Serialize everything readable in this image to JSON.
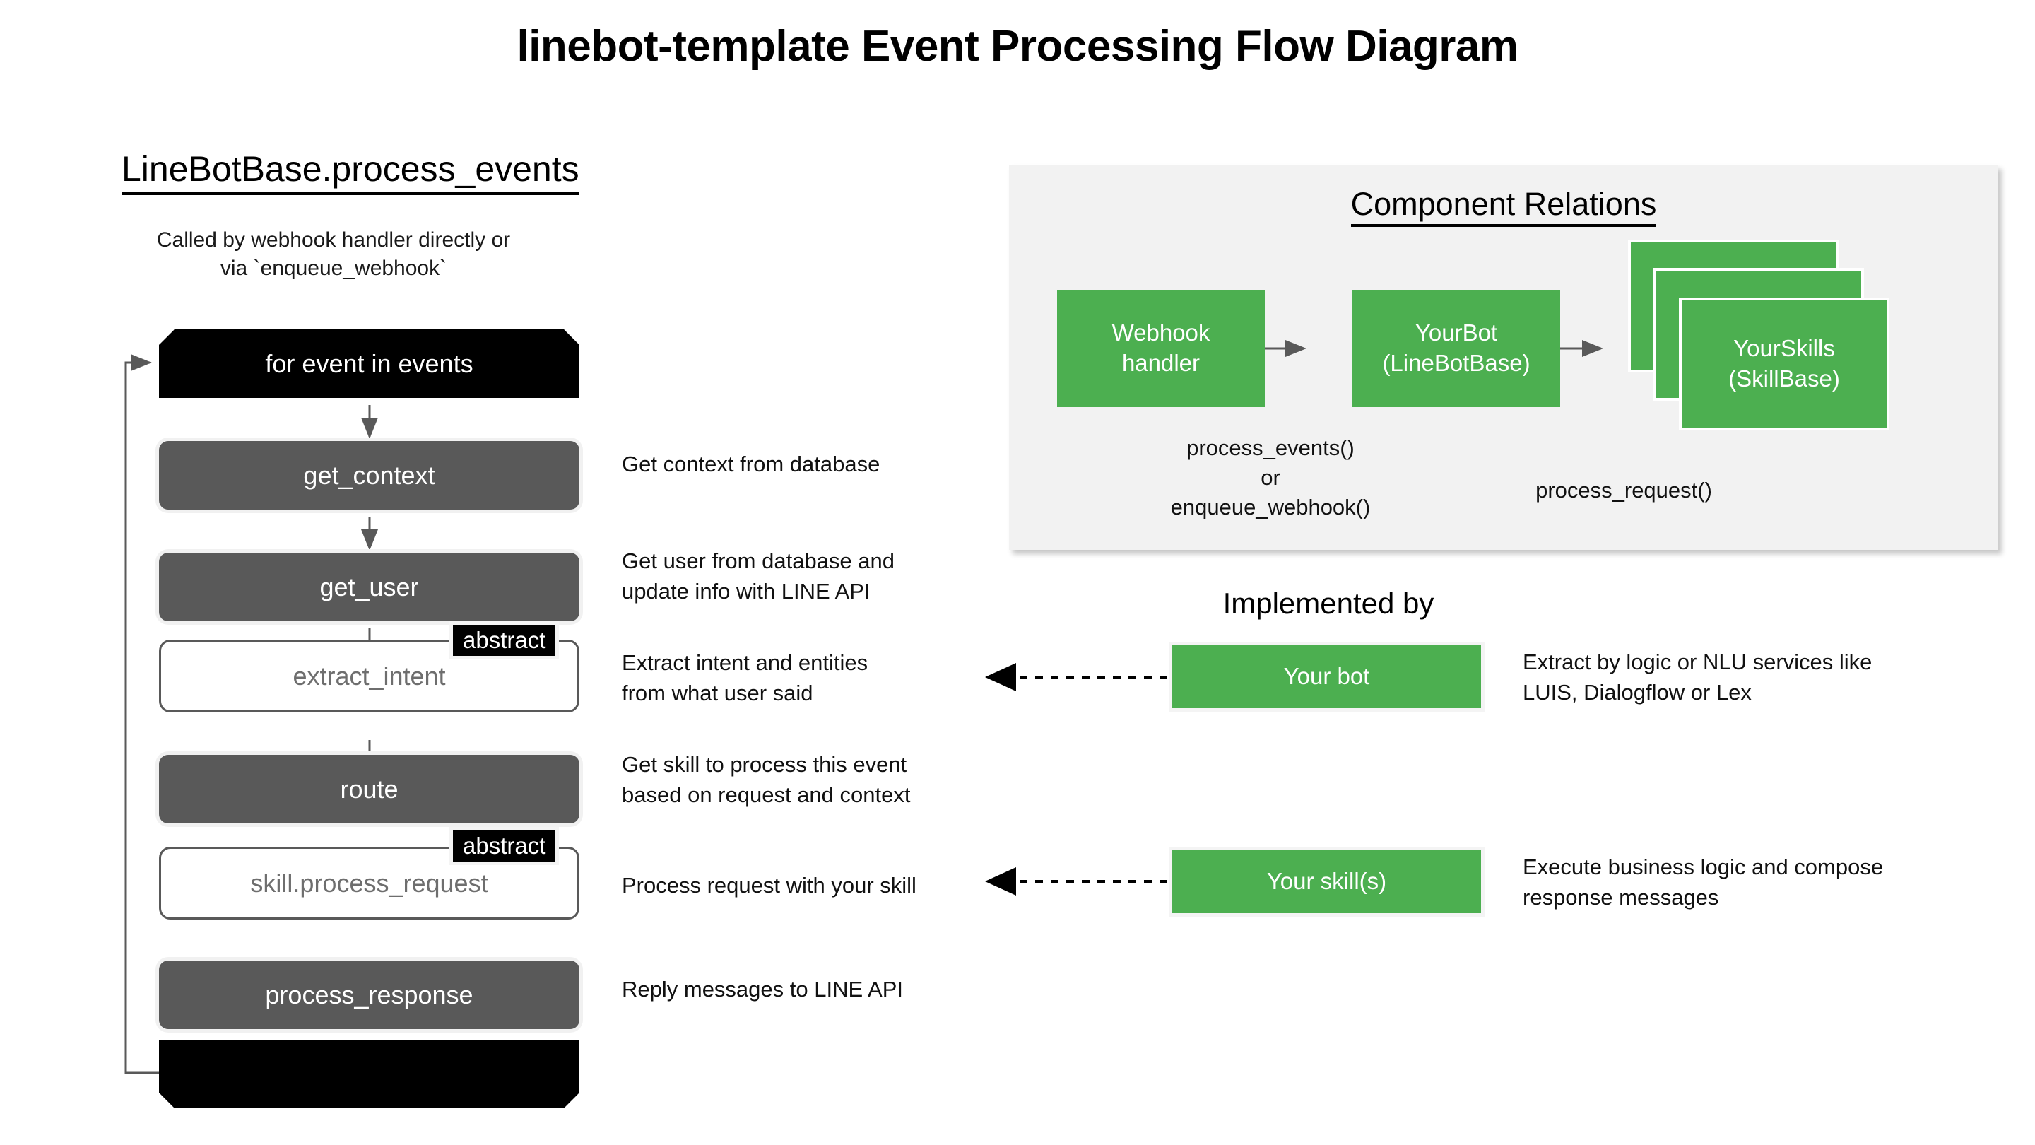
{
  "title": "linebot-template Event Processing Flow Diagram",
  "flow": {
    "heading": "LineBotBase.process_events",
    "subtitle": "Called by webhook handler directly or\nvia `enqueue_webhook`",
    "abstract_badge": "abstract",
    "nodes": [
      {
        "label": "for event in events",
        "style": "loop-start",
        "annotation": ""
      },
      {
        "label": "get_context",
        "style": "gray",
        "annotation": "Get context from database"
      },
      {
        "label": "get_user",
        "style": "gray",
        "annotation": "Get user from database and\nupdate info with LINE API"
      },
      {
        "label": "extract_intent",
        "style": "abstract",
        "annotation": "Extract intent and entities\nfrom what user said"
      },
      {
        "label": "route",
        "style": "gray",
        "annotation": "Get skill to process this event\nbased on request and context"
      },
      {
        "label": "skill.process_request",
        "style": "abstract",
        "annotation": "Process request with your skill"
      },
      {
        "label": "process_response",
        "style": "gray",
        "annotation": "Reply messages to LINE API"
      },
      {
        "label": "",
        "style": "loop-end",
        "annotation": ""
      }
    ]
  },
  "component_relations": {
    "title": "Component Relations",
    "boxes": [
      {
        "label": "Webhook\nhandler"
      },
      {
        "label": "YourBot\n(LineBotBase)"
      },
      {
        "label": "YourSkills\n(SkillBase)"
      }
    ],
    "captions": [
      "process_events()\nor\nenqueue_webhook()",
      "process_request()"
    ]
  },
  "implemented_by": {
    "heading": "Implemented by",
    "items": [
      {
        "label": "Your bot",
        "description": "Extract by logic or NLU services like\nLUIS, Dialogflow or Lex"
      },
      {
        "label": "Your skill(s)",
        "description": "Execute business logic and compose\nresponse messages"
      }
    ]
  },
  "colors": {
    "green": "#4CAF50",
    "gray": "#595959",
    "black": "#000000",
    "panel_bg": "#F2F2F2"
  }
}
